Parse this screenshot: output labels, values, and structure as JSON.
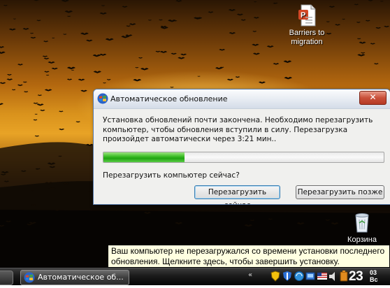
{
  "desktop": {
    "icons": [
      {
        "name": "presentation-file-icon",
        "label_line1": "Barriers to",
        "label_line2": "migration"
      },
      {
        "name": "recycle-bin-icon",
        "label": "Корзина"
      }
    ]
  },
  "dialog": {
    "title": "Автоматическое обновление",
    "close_label": "✕",
    "message": "Установка обновлений почти закончена. Необходимо перезагрузить компьютер, чтобы обновления вступили в силу. Перезагрузка произойдет автоматически через 3:21 мин..",
    "progress_fraction": 0.29,
    "question": "Перезагрузить компьютер сейчас?",
    "restart_now_label": "Перезагрузить сейчас",
    "restart_later_label": "Перезагрузить позже",
    "accent_color": "#3fbf2a"
  },
  "balloon": {
    "text": "Ваш компьютер не перезагружался со времени установки последнего обновления. Щелкните здесь, чтобы завершить установку."
  },
  "taskbar": {
    "task_label": "Автоматическое об...",
    "show_hidden_icon": "«",
    "tray_icons": [
      "shield-icon",
      "security-center-icon",
      "network-icon",
      "update-icon",
      "language-flag-icon",
      "volume-icon",
      "battery-icon"
    ],
    "clock_main": "23",
    "clock_sup": "03",
    "clock_sub": "Вс"
  }
}
